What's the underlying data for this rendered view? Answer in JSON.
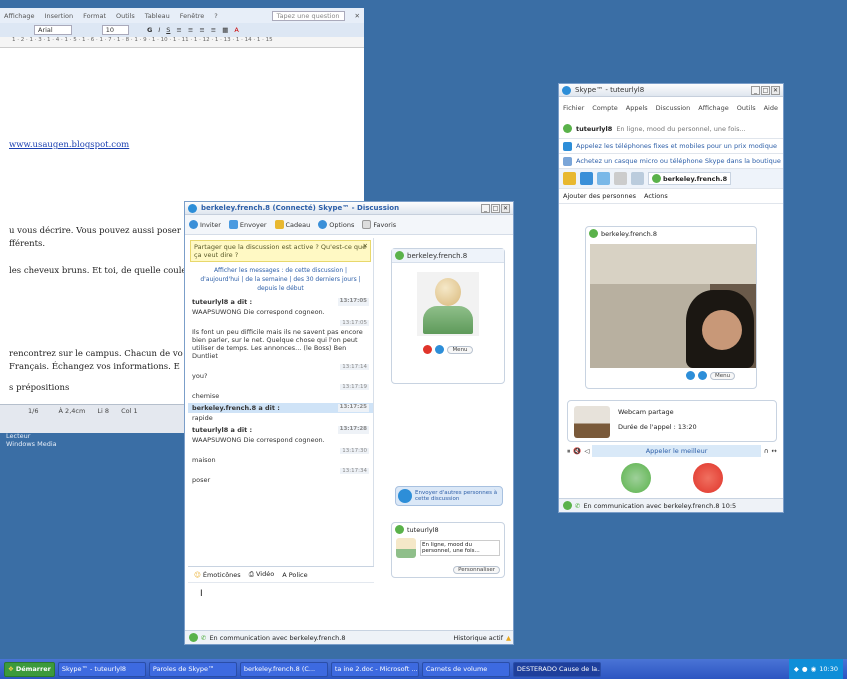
{
  "word": {
    "menu": [
      "Affichage",
      "Insertion",
      "Format",
      "Outils",
      "Tableau",
      "Fenêtre",
      "?"
    ],
    "help_placeholder": "Tapez une question",
    "font": "Arial",
    "size": "10",
    "ruler": "1 · 2 · 1 · 3 · 1 · 4 · 1 · 5 · 1 · 6 · 1 · 7 · 1 · 8 · 1 · 9 · 1 · 10 · 1 · 11 · 1 · 12 · 1 · 13 · 1 · 14 · 1 · 15",
    "lines": [
      "www.usaugen.blogspot.com",
      "u vous décrire. Vous pouvez aussi poser",
      "fférents.",
      "les cheveux bruns. Et toi, de quelle couleur",
      "rencontrez sur le campus. Chacun de vo",
      "Français. Échangez vos informations. E",
      "s prépositions"
    ],
    "status": [
      "1/6",
      "À 2,4cm",
      "Li 8",
      "Col 1"
    ],
    "desktop_label": [
      "Lecteur",
      "Windows Media"
    ]
  },
  "chat": {
    "title": "berkeley.french.8 (Connecté) Skype™ - Discussion",
    "toolbar": [
      "Inviter",
      "Envoyer",
      "Cadeau",
      "Options",
      "Favoris"
    ],
    "notice": "Partager que la discussion est active ? Qu'est-ce que ça veut dire ?",
    "history_links": "Afficher les messages : de cette discussion | d'aujourd'hui | de la semaine | des 30 derniers jours | depuis le début",
    "messages": [
      {
        "name": "tuteurlyl8 a dit :",
        "time": "13:17:05",
        "text": "WAAPSUWONG Die correspond cogneon.",
        "hl": false
      },
      {
        "name": "",
        "time": "13:17:05",
        "text": "Ils font un peu difficile mais ils ne savent pas encore bien parler, sur le net. Quelque chose qui l'on peut utiliser de temps. Les annonces... (le Boss) Ben Duntliet",
        "hl": false
      },
      {
        "name": "",
        "time": "13:17:14",
        "text": "you?",
        "hl": false
      },
      {
        "name": "",
        "time": "13:17:19",
        "text": "chemise",
        "hl": false
      },
      {
        "name": "berkeley.french.8 a dit :",
        "time": "13:17:25",
        "text": "rapide",
        "hl": true
      },
      {
        "name": "tuteurlyl8 a dit :",
        "time": "13:17:28",
        "text": "WAAPSUWONG Die correspond cogneon.",
        "hl": false
      },
      {
        "name": "",
        "time": "13:17:30",
        "text": "maison",
        "hl": false
      },
      {
        "name": "",
        "time": "13:17:34",
        "text": "poser",
        "hl": false
      }
    ],
    "input_tools": [
      "Émoticônes",
      "Vidéo",
      "Police"
    ],
    "contact_name": "berkeley.french.8",
    "contact_menu": "Menu",
    "send_to_others": "Envoyer d'autres personnes à cette discussion",
    "me_name": "tuteurlyl8",
    "me_mood": "En ligne, mood du personnel, une fois...",
    "me_button": "Personnaliser",
    "status_bar": "En communication avec berkeley.french.8",
    "history_label": "Historique actif"
  },
  "skype": {
    "title": "Skype™ - tuteurlyl8",
    "menu": [
      "Fichier",
      "Compte",
      "Appels",
      "Discussion",
      "Affichage",
      "Outils",
      "Aide"
    ],
    "user": "tuteurlyl8",
    "mood": "En ligne, mood du personnel, une fois...",
    "promo1": "Appelez les téléphones fixes et mobiles pour un prix modique",
    "promo2": "Achetez un casque micro ou téléphone Skype dans la boutique",
    "contact": "berkeley.french.8",
    "subbar": [
      "Ajouter des personnes",
      "Actions"
    ],
    "video_title": "berkeley.french.8",
    "video_menu": "Menu",
    "call_title": "Webcam partage",
    "call_duration": "Durée de l'appel : 13:20",
    "call_status": "Appeler le meilleur",
    "status_bar": "En communication avec berkeley.french.8  10:5"
  },
  "taskbar": {
    "start": "Démarrer",
    "items": [
      {
        "label": "Skype™ - tuteurlyl8",
        "active": false
      },
      {
        "label": "Paroles de Skype™",
        "active": false
      },
      {
        "label": "berkeley.french.8 (C...",
        "active": false
      },
      {
        "label": "ta ine 2.doc - Microsoft ...",
        "active": false
      },
      {
        "label": "Carnets de volume",
        "active": false
      },
      {
        "label": "DESTERADO Cause de la...",
        "active": true
      }
    ],
    "clock": "10:30"
  },
  "colors": {
    "desktop": "#3a6ea5",
    "call_green": "#5ab24a",
    "call_red": "#e0342a",
    "skype_blue": "#2d8ed8"
  }
}
